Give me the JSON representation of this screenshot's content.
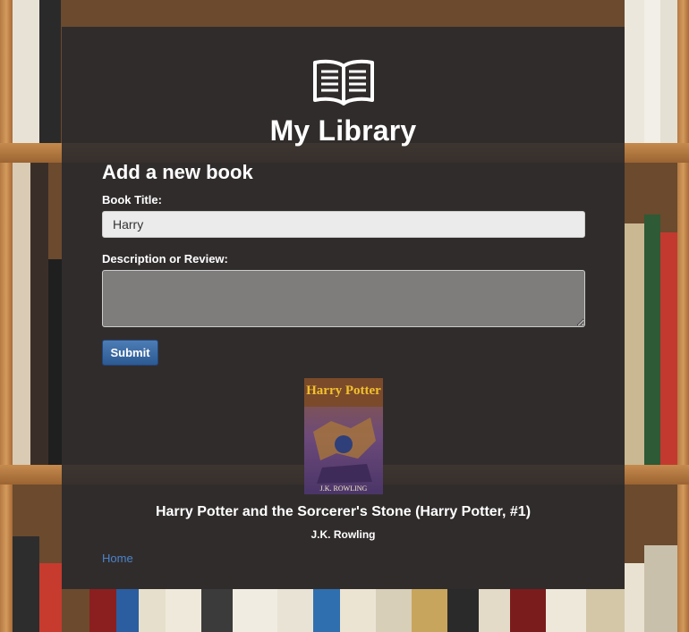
{
  "app": {
    "title": "My Library",
    "logo_icon": "open-book-icon"
  },
  "form": {
    "heading": "Add a new book",
    "title_label": "Book Title:",
    "title_value": "Harry",
    "description_label": "Description or Review:",
    "description_value": "",
    "submit_label": "Submit"
  },
  "result": {
    "cover_title_text": "Harry Potter",
    "cover_author_text": "J.K. ROWLING",
    "book_title": "Harry Potter and the Sorcerer's Stone (Harry Potter, #1)",
    "author": "J.K. Rowling"
  },
  "nav": {
    "home_label": "Home"
  },
  "colors": {
    "panel": "#28282c",
    "link": "#4a84c9",
    "button": "#2c5a93"
  }
}
